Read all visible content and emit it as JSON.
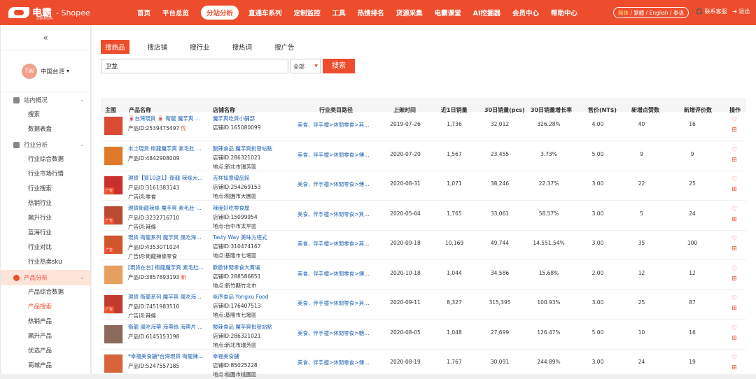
{
  "brand": {
    "name": "电霸",
    "tagline": "DIANBA",
    "suffix": "- Shopee"
  },
  "nav": [
    "首页",
    "平台总览",
    "分站分析",
    "直通车系列",
    "定制监控",
    "工具",
    "热搜排名",
    "货源采集",
    "电霸课堂",
    "AI挖掘器",
    "会员中心",
    "帮助中心"
  ],
  "nav_active": 2,
  "lang": {
    "active": "简体",
    "rest": " / 繁體 / English / 泰语"
  },
  "contact": "联系客服",
  "logout": "退出",
  "sidebar": {
    "collapse": "«",
    "region": {
      "avatar": "TW",
      "label": "中国台湾"
    },
    "groups": [
      {
        "label": "站内概况",
        "items": [
          "搜索",
          "数据表盘"
        ]
      },
      {
        "label": "行业分析",
        "items": [
          "行业综合数据",
          "行业市场行情",
          "行业搜索",
          "热销行业",
          "飙升行业",
          "蓝海行业",
          "行业对比",
          "行业热卖sku"
        ]
      },
      {
        "label": "产品分析",
        "items": [
          "产品综合数据",
          "产品搜索",
          "热销产品",
          "飙升产品",
          "优选产品",
          "商城产品"
        ]
      }
    ],
    "active_item": "产品搜索"
  },
  "tabs": [
    "搜商品",
    "搜店铺",
    "搜行业",
    "搜热词",
    "搜广告"
  ],
  "search": {
    "value": "卫龙",
    "select": "全部",
    "button": "搜索"
  },
  "columns": [
    "主图",
    "产品名称",
    "店铺名称",
    "行业类目路径",
    "上架时间",
    "近1日销量",
    "30日销量(pcs)",
    "30日销量增长率",
    "售价(NT$)",
    "新增点赞数",
    "新增评价数",
    "操作"
  ],
  "rows": [
    {
      "name": "🀄台灣現貨 🀄 衛龍 魔芋爽 香辣...",
      "id": "产品ID:2539475497",
      "tag": "优",
      "extra": "",
      "shop": "魔芋爽吃貨小舖部",
      "shop_id": "店铺ID:165080099",
      "shop_loc": "",
      "cat": "美食、伴手禮>休閒零食>其他休...",
      "date": "2019-07-26",
      "d1": "1,736",
      "d30": "32,012",
      "growth": "326.28%",
      "price": "4.00",
      "likes": "40",
      "reviews": "16",
      "ad": false
    },
    {
      "name": "本土現貨 衛龍魔芋爽 素毛肚 香辣...",
      "id": "产品ID:4842908009",
      "tag": "",
      "extra": "",
      "shop": "酸辣食品 魔芋爽批發站點",
      "shop_id": "店铺ID:286321021",
      "shop_loc": "地点:新北市瑞芳區",
      "cat": "美食、伴手禮>休閒零食>傳統零...",
      "date": "2020-07-20",
      "d1": "1,567",
      "d30": "23,455",
      "growth": "3.73%",
      "price": "5.00",
      "likes": "9",
      "reviews": "9",
      "ad": false
    },
    {
      "name": "現貨【買10送1】衛龍 辣條大辣棒...",
      "id": "产品ID:3161383143",
      "tag": "",
      "extra": "广告词:零食",
      "shop": "吉祥如意優品館",
      "shop_id": "店铺ID:254269153",
      "shop_loc": "地点:桃園市大園區",
      "cat": "美食、伴手禮>休閒零食>傳統零...",
      "date": "2020-08-31",
      "d1": "1,071",
      "d30": "38,246",
      "growth": "22.37%",
      "price": "3.00",
      "likes": "22",
      "reviews": "25",
      "ad": true
    },
    {
      "name": "現貨衛龍辣條 魔芋爽 素毛肚 親嘴...",
      "id": "产品ID:3232716710",
      "tag": "",
      "extra": "广告词:辣條",
      "shop": "辣度好吃零食屋",
      "shop_id": "店铺ID:15099954",
      "shop_loc": "地点:台中市太平區",
      "cat": "美食、伴手禮>休閒零食>其他休...",
      "date": "2020-05-04",
      "d1": "1,765",
      "d30": "33,061",
      "growth": "58.57%",
      "price": "3.00",
      "likes": "5",
      "reviews": "24",
      "ad": true
    },
    {
      "name": "現貨 衛龍系列 魔芋爽 風吃海帶...",
      "id": "产品ID:4353071024",
      "tag": "",
      "extra": "广告词:衛龍辣條零食",
      "shop": "Tasty Way 美味方程式",
      "shop_id": "店铺ID:310474167",
      "shop_loc": "地点:基隆市七堵區",
      "cat": "美食、伴手禮>休閒零食>其他休...",
      "date": "2020-09-18",
      "d1": "10,169",
      "d30": "49,744",
      "growth": "14,551.54%",
      "price": "3.00",
      "likes": "35",
      "reviews": "100",
      "ad": true
    },
    {
      "name": "[現貨在台] 衛龍魔芋爽 素毛肚 魔...",
      "id": "产品ID:3857893193",
      "tag": "新",
      "extra": "",
      "shop": "歡歡休閒零食大賣場",
      "shop_id": "店铺ID:288586851",
      "shop_loc": "地点:新竹縣竹北市",
      "cat": "美食、伴手禮>休閒零食>傳統零...",
      "date": "2020-10-18",
      "d1": "1,044",
      "d30": "34,586",
      "growth": "15.68%",
      "price": "2.00",
      "likes": "12",
      "reviews": "12",
      "ad": false
    },
    {
      "name": "現貨 衛龍系列 魔芋爽 風吃海帶...",
      "id": "产品ID:7451983510",
      "tag": "",
      "extra": "广告词:辣條",
      "shop": "咏序食品 Yongxu Food",
      "shop_id": "店铺ID:176407513",
      "shop_loc": "地点:基隆市七堵區",
      "cat": "美食、伴手禮>休閒零食>其他休...",
      "date": "2020-09-11",
      "d1": "8,327",
      "d30": "315,395",
      "growth": "100.93%",
      "price": "3.00",
      "likes": "25",
      "reviews": "87",
      "ad": true
    },
    {
      "name": "衛龍 風吃海帶 海帶絲 海帶片 道...",
      "id": "产品ID:6145153198",
      "tag": "",
      "extra": "",
      "shop": "酸辣食品 魔芋爽批發站點",
      "shop_id": "店铺ID:286321021",
      "shop_loc": "地点:新北市瑞芳區",
      "cat": "美食、伴手禮>休閒零食>糖果、...",
      "date": "2020-08-05",
      "d1": "1,048",
      "d30": "27,699",
      "growth": "126.47%",
      "price": "5.00",
      "likes": "10",
      "reviews": "16",
      "ad": false
    },
    {
      "name": "*幸福美食舖*台灣現貨 衛龍辣條...",
      "id": "产品ID:5247557185",
      "tag": "",
      "extra": "",
      "shop": "幸福美食舖",
      "shop_id": "店铺ID:85025228",
      "shop_loc": "地点:桃園市桃園區",
      "cat": "美食、伴手禮>休閒零食>傳統零...",
      "date": "2020-08-19",
      "d1": "1,767",
      "d30": "30,091",
      "growth": "244.89%",
      "price": "3.00",
      "likes": "24",
      "reviews": "19",
      "ad": false
    }
  ],
  "ad_label": "广告",
  "colors": {
    "accent": "#ee4d2d",
    "link": "#1a5fb4"
  },
  "icons": {
    "favorite": "heart-icon",
    "cart": "cart-icon"
  }
}
